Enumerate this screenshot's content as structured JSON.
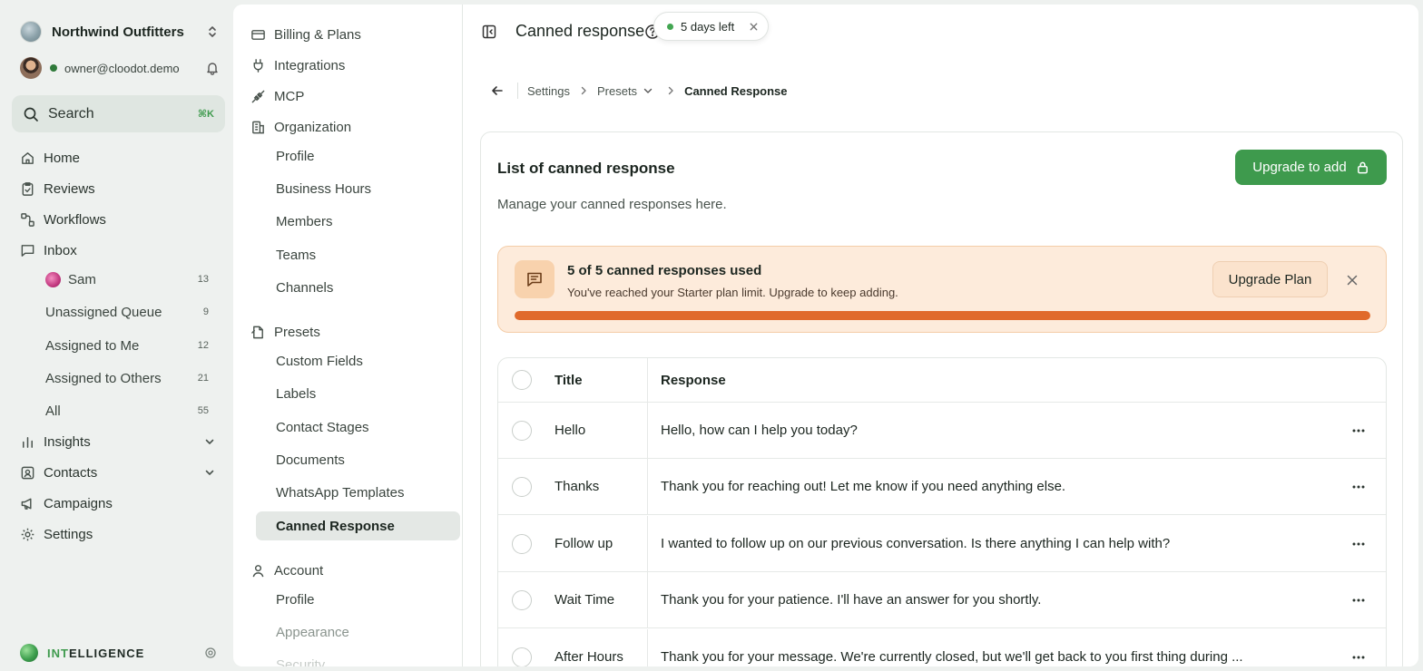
{
  "workspace": {
    "name": "Northwind Outfitters"
  },
  "user": {
    "email": "owner@cloodot.demo"
  },
  "search": {
    "label": "Search",
    "shortcut": "⌘K"
  },
  "nav": {
    "home": "Home",
    "reviews": "Reviews",
    "workflows": "Workflows",
    "inbox": "Inbox",
    "inbox_items": [
      {
        "label": "Sam",
        "count": "13"
      },
      {
        "label": "Unassigned Queue",
        "count": "9"
      },
      {
        "label": "Assigned to Me",
        "count": "12"
      },
      {
        "label": "Assigned to Others",
        "count": "21"
      },
      {
        "label": "All",
        "count": "55"
      }
    ],
    "insights": "Insights",
    "contacts": "Contacts",
    "campaigns": "Campaigns",
    "settings": "Settings"
  },
  "intelligence": {
    "accent": "INT",
    "rest": "ELLIGENCE"
  },
  "settings_panel": {
    "billing": "Billing & Plans",
    "integrations": "Integrations",
    "mcp": "MCP",
    "organization": "Organization",
    "org_items": [
      "Profile",
      "Business Hours",
      "Members",
      "Teams",
      "Channels"
    ],
    "presets": "Presets",
    "preset_items": [
      "Custom Fields",
      "Labels",
      "Contact Stages",
      "Documents",
      "WhatsApp Templates",
      "Canned Response"
    ],
    "account": "Account",
    "account_items": [
      "Profile",
      "Appearance",
      "Security"
    ]
  },
  "topbar": {
    "title": "Canned response",
    "trial": "5 days left"
  },
  "breadcrumb": {
    "settings": "Settings",
    "presets": "Presets",
    "current": "Canned Response"
  },
  "card": {
    "title": "List of canned response",
    "subtitle": "Manage your canned responses here.",
    "upgrade_button": "Upgrade to add"
  },
  "limit_banner": {
    "title": "5 of 5 canned responses used",
    "description": "You've reached your Starter plan limit. Upgrade to keep adding.",
    "button": "Upgrade Plan",
    "used": 5,
    "max": 5
  },
  "table": {
    "columns": [
      "Title",
      "Response"
    ],
    "rows": [
      {
        "title": "Hello",
        "response": "Hello, how can I help you today?"
      },
      {
        "title": "Thanks",
        "response": "Thank you for reaching out! Let me know if you need anything else."
      },
      {
        "title": "Follow up",
        "response": "I wanted to follow up on our previous conversation. Is there anything I can help with?"
      },
      {
        "title": "Wait Time",
        "response": "Thank you for your patience. I'll have an answer for you shortly."
      },
      {
        "title": "After Hours",
        "response": "Thank you for your message. We're currently closed, but we'll get back to you first thing during ..."
      }
    ]
  },
  "colors": {
    "brand_green": "#3e9a4d",
    "warning_bg": "#fdebdb",
    "progress": "#e06a2b"
  }
}
